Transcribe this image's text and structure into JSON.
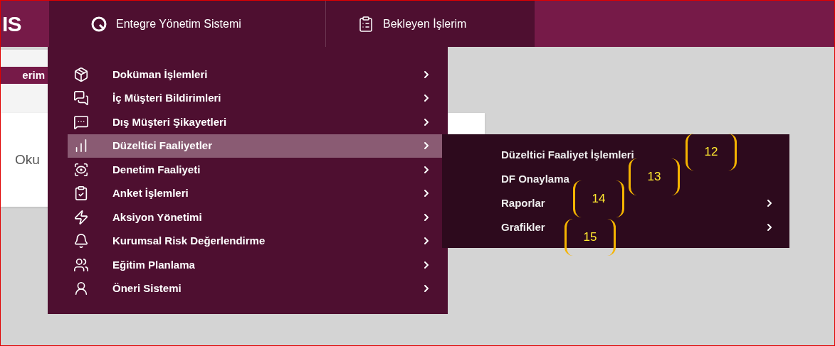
{
  "header": {
    "logo": "IS",
    "nav": [
      {
        "label": "Entegre Yönetim Sistemi"
      },
      {
        "label": "Bekleyen İşlerim"
      }
    ]
  },
  "background": {
    "tab": "erim",
    "card_text": "Oku"
  },
  "menu": {
    "items": [
      {
        "label": "Doküman İşlemleri",
        "selected": false,
        "has_submenu": true
      },
      {
        "label": "İç Müşteri Bildirimleri",
        "selected": false,
        "has_submenu": true
      },
      {
        "label": "Dış Müşteri Şikayetleri",
        "selected": false,
        "has_submenu": true
      },
      {
        "label": "Düzeltici Faaliyetler",
        "selected": true,
        "has_submenu": true
      },
      {
        "label": "Denetim Faaliyeti",
        "selected": false,
        "has_submenu": true
      },
      {
        "label": "Anket İşlemleri",
        "selected": false,
        "has_submenu": true
      },
      {
        "label": "Aksiyon Yönetimi",
        "selected": false,
        "has_submenu": true
      },
      {
        "label": "Kurumsal Risk Değerlendirme",
        "selected": false,
        "has_submenu": true
      },
      {
        "label": "Eğitim Planlama",
        "selected": false,
        "has_submenu": true
      },
      {
        "label": "Öneri Sistemi",
        "selected": false,
        "has_submenu": true
      }
    ]
  },
  "submenu": {
    "items": [
      {
        "label": "Düzeltici Faaliyet İşlemleri",
        "has_submenu": false
      },
      {
        "label": "DF Onaylama",
        "has_submenu": false
      },
      {
        "label": "Raporlar",
        "has_submenu": true
      },
      {
        "label": "Grafikler",
        "has_submenu": true
      }
    ]
  },
  "callouts": [
    "12",
    "13",
    "14",
    "15"
  ]
}
